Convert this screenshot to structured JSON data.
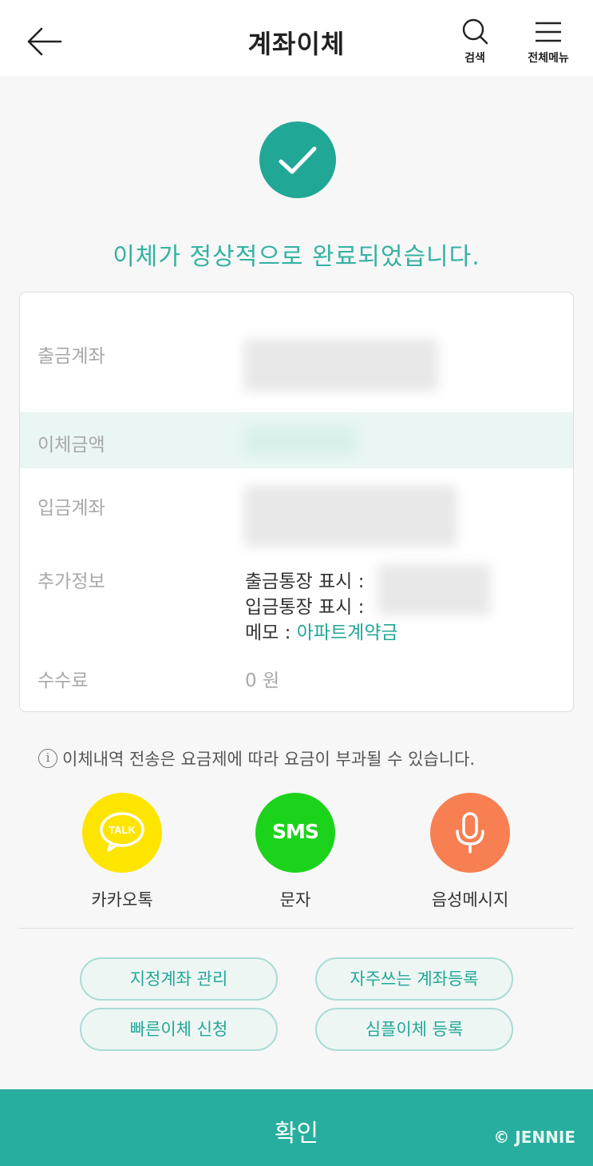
{
  "header": {
    "title": "계좌이체",
    "search_label": "검색",
    "menu_label": "전체메뉴"
  },
  "result": {
    "message": "이체가 정상적으로 완료되었습니다."
  },
  "details": {
    "withdraw_account_label": "출금계좌",
    "amount_label": "이체금액",
    "deposit_account_label": "입금계좌",
    "extra_info_label": "추가정보",
    "withdraw_display_label": "출금통장 표시 :",
    "deposit_display_label": "입금통장 표시 :",
    "memo_label": "메모 :",
    "memo_value": "아파트계약금",
    "fee_label": "수수료",
    "fee_value": "0 원"
  },
  "notice": {
    "icon_glyph": "i",
    "text": "이체내역 전송은 요금제에 따라 요금이 부과될 수 있습니다."
  },
  "share": {
    "kakao_label": "카카오톡",
    "kakao_icon_text": "TALK",
    "sms_label": "문자",
    "sms_icon_text": "SMS",
    "voice_label": "음성메시지"
  },
  "actions": {
    "designated_account": "지정계좌 관리",
    "frequent_account": "자주쓰는 계좌등록",
    "quick_transfer": "빠른이체 신청",
    "simple_transfer": "심플이체 등록"
  },
  "footer": {
    "confirm_label": "확인",
    "watermark": "© JENNIE"
  },
  "colors": {
    "accent": "#21a796",
    "confirm_bg": "#27ae9e",
    "kakao": "#fde500",
    "sms": "#1cd31c",
    "voice": "#f77f52"
  }
}
